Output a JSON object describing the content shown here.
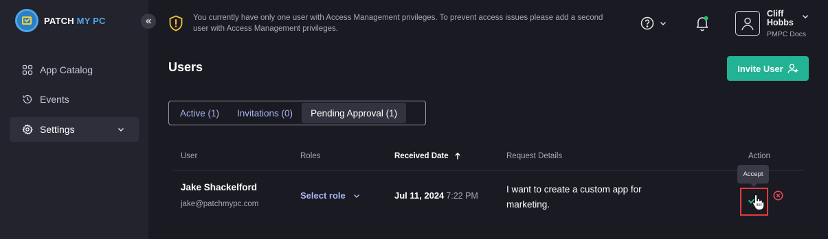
{
  "brand": {
    "name_part1": "PATCH ",
    "name_part2": "MY PC"
  },
  "sidebar": {
    "items": [
      {
        "label": "App Catalog",
        "icon": "grid-icon"
      },
      {
        "label": "Events",
        "icon": "history-icon"
      },
      {
        "label": "Settings",
        "icon": "gear-icon",
        "active": true
      }
    ]
  },
  "banner": {
    "text": "You currently have only one user with Access Management privileges. To prevent access issues please add a second user with Access Management privileges."
  },
  "user": {
    "name": "Cliff Hobbs",
    "org": "PMPC Docs"
  },
  "page": {
    "title": "Users",
    "invite_label": "Invite User"
  },
  "tabs": [
    {
      "label": "Active (1)"
    },
    {
      "label": "Invitations (0)"
    },
    {
      "label": "Pending Approval (1)",
      "selected": true
    }
  ],
  "table": {
    "headers": {
      "user": "User",
      "roles": "Roles",
      "received": "Received Date",
      "details": "Request Details",
      "action": "Action"
    },
    "rows": [
      {
        "name": "Jake Shackelford",
        "email": "jake@patchmypc.com",
        "role_placeholder": "Select role",
        "date": "Jul 11, 2024",
        "time": "7:22 PM",
        "details": "I want to create a custom app for marketing."
      }
    ]
  },
  "tooltip": {
    "accept": "Accept"
  },
  "colors": {
    "accent": "#22b394",
    "highlight": "#e53a3a",
    "danger": "#e04a5f"
  }
}
